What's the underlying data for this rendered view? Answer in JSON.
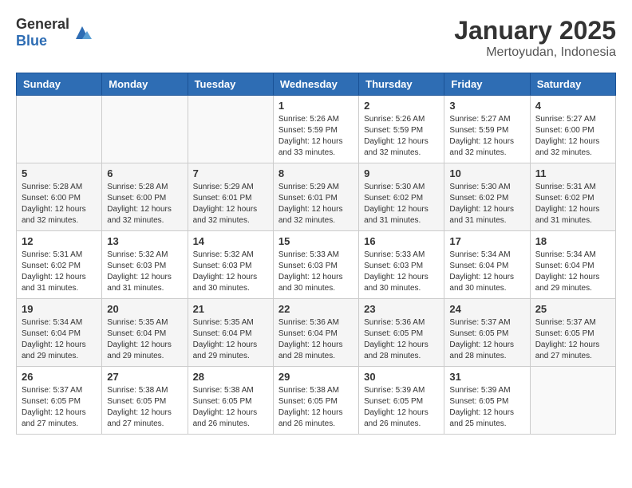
{
  "header": {
    "logo_general": "General",
    "logo_blue": "Blue",
    "title": "January 2025",
    "subtitle": "Mertoyudan, Indonesia"
  },
  "days_of_week": [
    "Sunday",
    "Monday",
    "Tuesday",
    "Wednesday",
    "Thursday",
    "Friday",
    "Saturday"
  ],
  "weeks": [
    [
      {
        "day": "",
        "info": ""
      },
      {
        "day": "",
        "info": ""
      },
      {
        "day": "",
        "info": ""
      },
      {
        "day": "1",
        "info": "Sunrise: 5:26 AM\nSunset: 5:59 PM\nDaylight: 12 hours and 33 minutes."
      },
      {
        "day": "2",
        "info": "Sunrise: 5:26 AM\nSunset: 5:59 PM\nDaylight: 12 hours and 32 minutes."
      },
      {
        "day": "3",
        "info": "Sunrise: 5:27 AM\nSunset: 5:59 PM\nDaylight: 12 hours and 32 minutes."
      },
      {
        "day": "4",
        "info": "Sunrise: 5:27 AM\nSunset: 6:00 PM\nDaylight: 12 hours and 32 minutes."
      }
    ],
    [
      {
        "day": "5",
        "info": "Sunrise: 5:28 AM\nSunset: 6:00 PM\nDaylight: 12 hours and 32 minutes."
      },
      {
        "day": "6",
        "info": "Sunrise: 5:28 AM\nSunset: 6:00 PM\nDaylight: 12 hours and 32 minutes."
      },
      {
        "day": "7",
        "info": "Sunrise: 5:29 AM\nSunset: 6:01 PM\nDaylight: 12 hours and 32 minutes."
      },
      {
        "day": "8",
        "info": "Sunrise: 5:29 AM\nSunset: 6:01 PM\nDaylight: 12 hours and 32 minutes."
      },
      {
        "day": "9",
        "info": "Sunrise: 5:30 AM\nSunset: 6:02 PM\nDaylight: 12 hours and 31 minutes."
      },
      {
        "day": "10",
        "info": "Sunrise: 5:30 AM\nSunset: 6:02 PM\nDaylight: 12 hours and 31 minutes."
      },
      {
        "day": "11",
        "info": "Sunrise: 5:31 AM\nSunset: 6:02 PM\nDaylight: 12 hours and 31 minutes."
      }
    ],
    [
      {
        "day": "12",
        "info": "Sunrise: 5:31 AM\nSunset: 6:02 PM\nDaylight: 12 hours and 31 minutes."
      },
      {
        "day": "13",
        "info": "Sunrise: 5:32 AM\nSunset: 6:03 PM\nDaylight: 12 hours and 31 minutes."
      },
      {
        "day": "14",
        "info": "Sunrise: 5:32 AM\nSunset: 6:03 PM\nDaylight: 12 hours and 30 minutes."
      },
      {
        "day": "15",
        "info": "Sunrise: 5:33 AM\nSunset: 6:03 PM\nDaylight: 12 hours and 30 minutes."
      },
      {
        "day": "16",
        "info": "Sunrise: 5:33 AM\nSunset: 6:03 PM\nDaylight: 12 hours and 30 minutes."
      },
      {
        "day": "17",
        "info": "Sunrise: 5:34 AM\nSunset: 6:04 PM\nDaylight: 12 hours and 30 minutes."
      },
      {
        "day": "18",
        "info": "Sunrise: 5:34 AM\nSunset: 6:04 PM\nDaylight: 12 hours and 29 minutes."
      }
    ],
    [
      {
        "day": "19",
        "info": "Sunrise: 5:34 AM\nSunset: 6:04 PM\nDaylight: 12 hours and 29 minutes."
      },
      {
        "day": "20",
        "info": "Sunrise: 5:35 AM\nSunset: 6:04 PM\nDaylight: 12 hours and 29 minutes."
      },
      {
        "day": "21",
        "info": "Sunrise: 5:35 AM\nSunset: 6:04 PM\nDaylight: 12 hours and 29 minutes."
      },
      {
        "day": "22",
        "info": "Sunrise: 5:36 AM\nSunset: 6:04 PM\nDaylight: 12 hours and 28 minutes."
      },
      {
        "day": "23",
        "info": "Sunrise: 5:36 AM\nSunset: 6:05 PM\nDaylight: 12 hours and 28 minutes."
      },
      {
        "day": "24",
        "info": "Sunrise: 5:37 AM\nSunset: 6:05 PM\nDaylight: 12 hours and 28 minutes."
      },
      {
        "day": "25",
        "info": "Sunrise: 5:37 AM\nSunset: 6:05 PM\nDaylight: 12 hours and 27 minutes."
      }
    ],
    [
      {
        "day": "26",
        "info": "Sunrise: 5:37 AM\nSunset: 6:05 PM\nDaylight: 12 hours and 27 minutes."
      },
      {
        "day": "27",
        "info": "Sunrise: 5:38 AM\nSunset: 6:05 PM\nDaylight: 12 hours and 27 minutes."
      },
      {
        "day": "28",
        "info": "Sunrise: 5:38 AM\nSunset: 6:05 PM\nDaylight: 12 hours and 26 minutes."
      },
      {
        "day": "29",
        "info": "Sunrise: 5:38 AM\nSunset: 6:05 PM\nDaylight: 12 hours and 26 minutes."
      },
      {
        "day": "30",
        "info": "Sunrise: 5:39 AM\nSunset: 6:05 PM\nDaylight: 12 hours and 26 minutes."
      },
      {
        "day": "31",
        "info": "Sunrise: 5:39 AM\nSunset: 6:05 PM\nDaylight: 12 hours and 25 minutes."
      },
      {
        "day": "",
        "info": ""
      }
    ]
  ]
}
